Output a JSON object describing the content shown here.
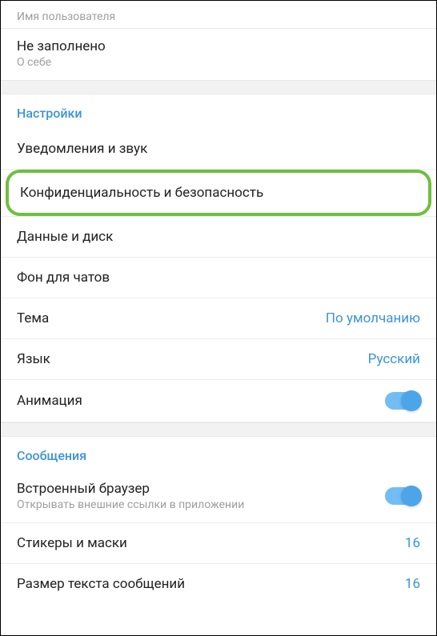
{
  "profile": {
    "username_label": "Имя пользователя",
    "bio_title": "Не заполнено",
    "bio_label": "О себе"
  },
  "settings": {
    "header": "Настройки",
    "notifications": "Уведомления и звук",
    "privacy": "Конфиденциальность и безопасность",
    "data_disk": "Данные и диск",
    "chat_background": "Фон для чатов",
    "theme_label": "Тема",
    "theme_value": "По умолчанию",
    "language_label": "Язык",
    "language_value": "Русский",
    "animation_label": "Анимация"
  },
  "messages": {
    "header": "Сообщения",
    "builtin_browser_title": "Встроенный браузер",
    "builtin_browser_subtitle": "Открывать внешние ссылки в приложении",
    "stickers_label": "Стикеры и маски",
    "stickers_value": "16",
    "text_size_label": "Размер текста сообщений",
    "text_size_value": "16"
  }
}
